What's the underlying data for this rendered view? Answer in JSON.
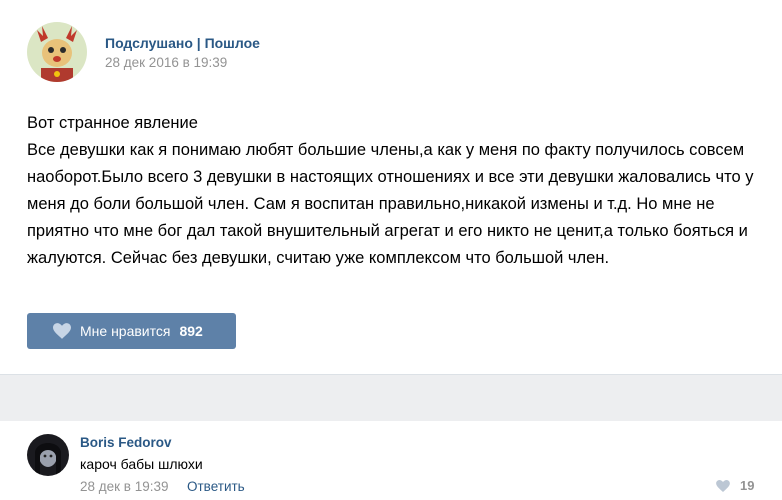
{
  "post": {
    "author": "Подслушано | Пошлое",
    "date": "28 дек 2016 в 19:39",
    "text_lines": [
      "Вот странное явление",
      "Все девушки как я понимаю любят большие члены,а как у меня по факту получилось совсем наоборот.Было всего 3 девушки в настоящих отношениях и все эти девушки жаловались что у меня до боли большой член. Сам я воспитан правильно,никакой измены и т.д. Но мне не приятно что мне бог дал такой внушительный агрегат и его никто не ценит,а только бояться и жалуются. Сейчас без девушки, считаю уже комплексом что большой член."
    ],
    "like_label": "Мне нравится",
    "like_count": "892",
    "avatar_icon": "deer-mascot-avatar",
    "like_icon": "heart-icon",
    "accent_color": "#5e81a8",
    "link_color": "#2a5885"
  },
  "comment": {
    "author": "Boris Fedorov",
    "text": "кароч бабы шлюхи",
    "date": "28 дек в 19:39",
    "reply_label": "Ответить",
    "like_count": "19",
    "avatar_icon": "user-photo-avatar",
    "like_icon": "heart-icon"
  }
}
